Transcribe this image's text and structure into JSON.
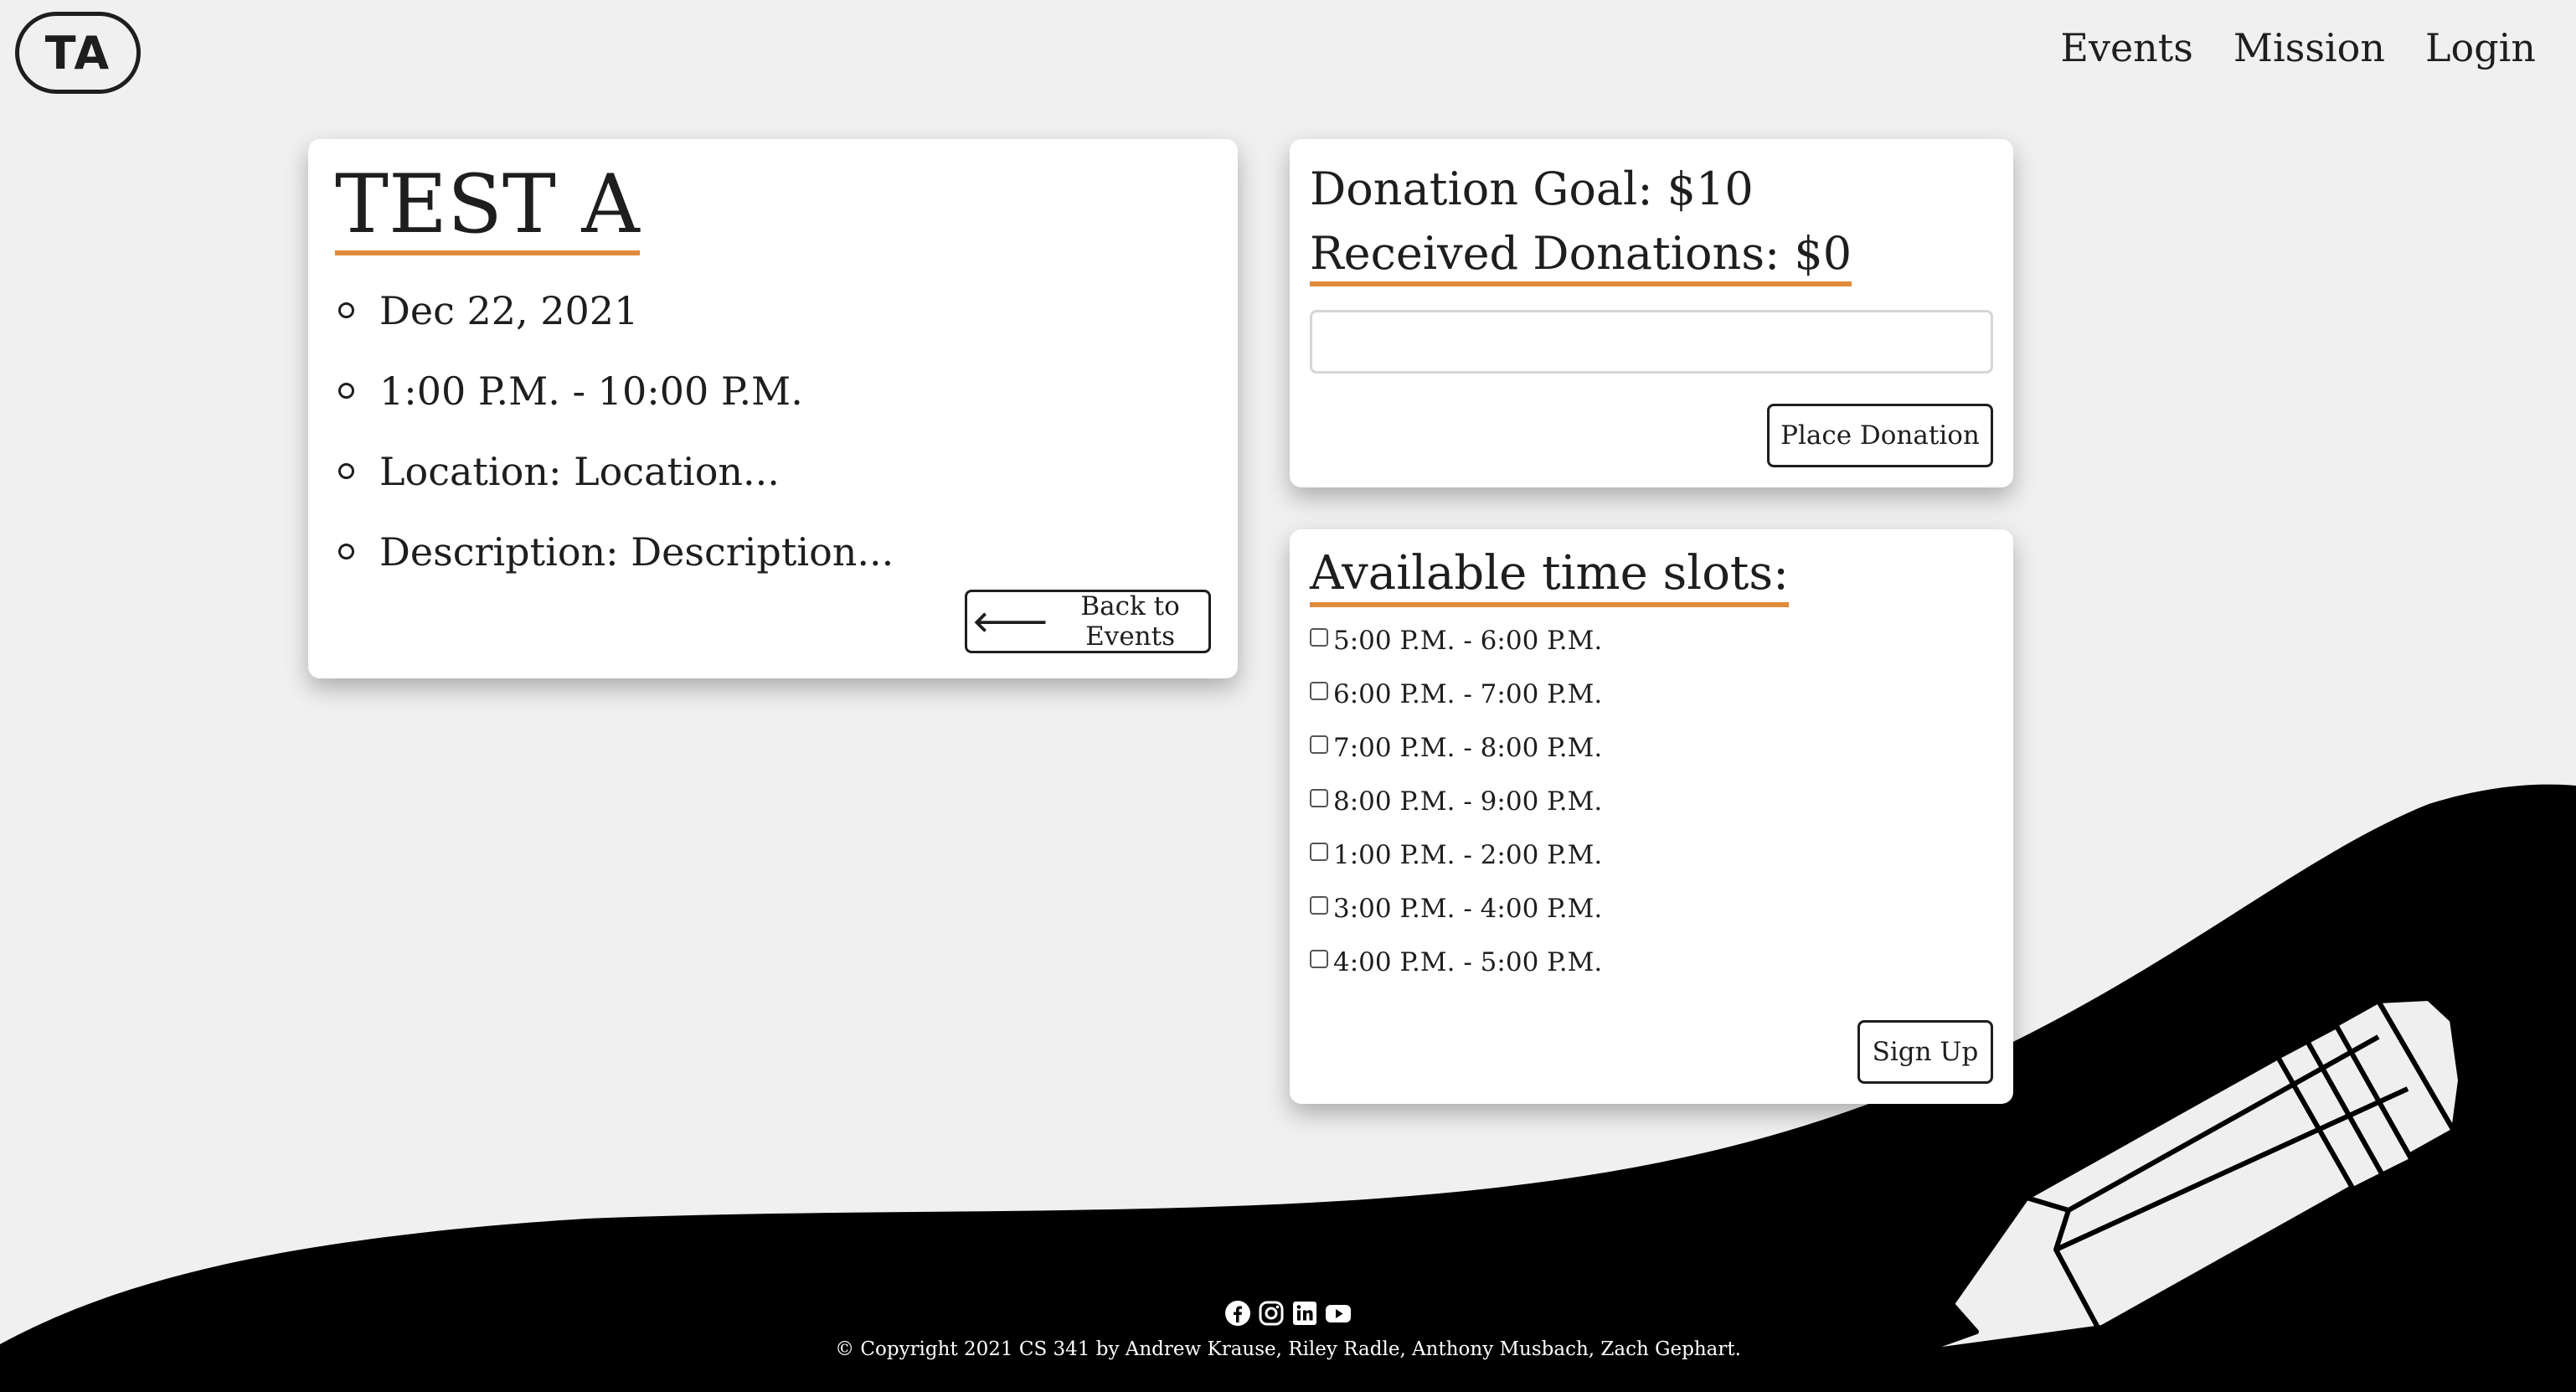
{
  "header": {
    "logo_text": "TA",
    "nav": [
      "Events",
      "Mission",
      "Login"
    ]
  },
  "event": {
    "title": "TEST A",
    "details": [
      "Dec 22, 2021",
      "1:00 P.M. - 10:00 P.M.",
      "Location: Location...",
      "Description: Description..."
    ],
    "back_label": "Back to Events"
  },
  "donation": {
    "goal_text": "Donation Goal: $10",
    "received_text": "Received Donations: $0",
    "input_value": "",
    "place_label": "Place Donation"
  },
  "slots": {
    "title": "Available time slots:",
    "items": [
      "5:00 P.M. - 6:00 P.M.",
      "6:00 P.M. - 7:00 P.M.",
      "7:00 P.M. - 8:00 P.M.",
      "8:00 P.M. - 9:00 P.M.",
      "1:00 P.M. - 2:00 P.M.",
      "3:00 P.M. - 4:00 P.M.",
      "4:00 P.M. - 5:00 P.M."
    ],
    "signup_label": "Sign Up"
  },
  "footer": {
    "social_icons": [
      "facebook-icon",
      "instagram-icon",
      "linkedin-icon",
      "youtube-icon"
    ],
    "copyright": "© Copyright 2021 CS 341 by Andrew Krause, Riley Radle, Anthony Musbach, Zach Gephart."
  },
  "colors": {
    "background": "#f0f0f0",
    "accent": "#e08a3c",
    "footer": "#000000",
    "card": "#ffffff"
  }
}
